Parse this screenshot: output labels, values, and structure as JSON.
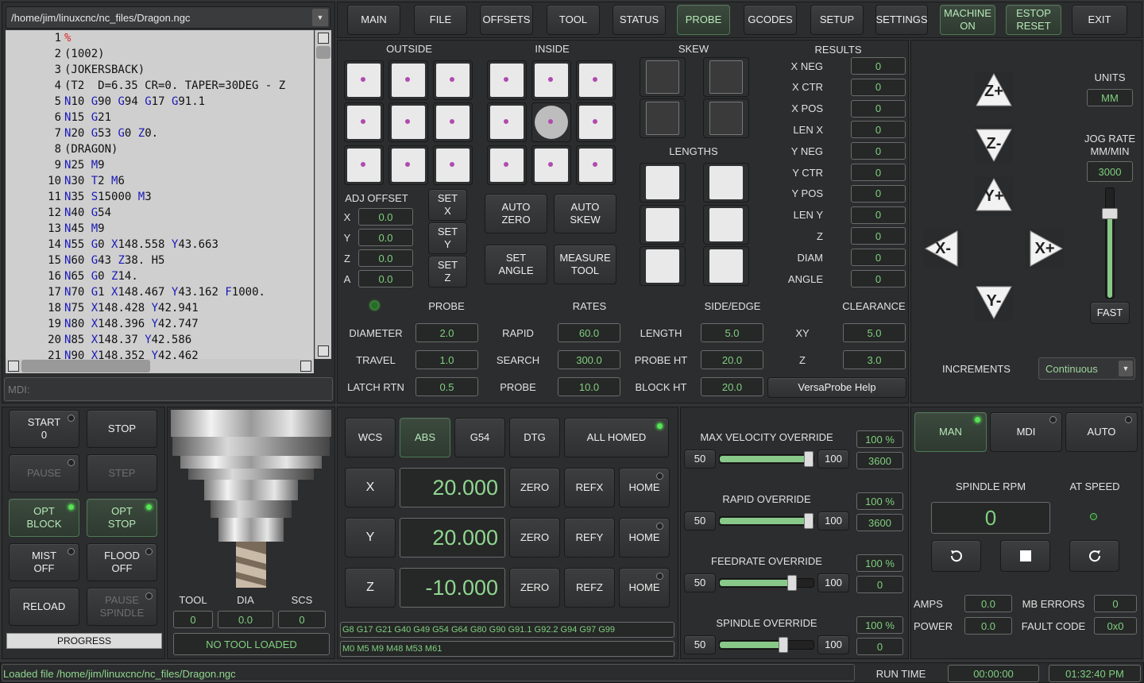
{
  "file": {
    "path": "/home/jim/linuxcnc/nc_files/Dragon.ngc"
  },
  "gcode_lines": [
    {
      "n": "1",
      "t": "%"
    },
    {
      "n": "2",
      "t": "(1002)"
    },
    {
      "n": "3",
      "t": "(JOKERSBACK)"
    },
    {
      "n": "4",
      "t": "(T2  D=6.35 CR=0. TAPER=30DEG - Z"
    },
    {
      "n": "5",
      "t": "N10 G90 G94 G17 G91.1"
    },
    {
      "n": "6",
      "t": "N15 G21"
    },
    {
      "n": "7",
      "t": "N20 G53 G0 Z0."
    },
    {
      "n": "8",
      "t": "(DRAGON)"
    },
    {
      "n": "9",
      "t": "N25 M9"
    },
    {
      "n": "10",
      "t": "N30 T2 M6"
    },
    {
      "n": "11",
      "t": "N35 S15000 M3"
    },
    {
      "n": "12",
      "t": "N40 G54"
    },
    {
      "n": "13",
      "t": "N45 M9"
    },
    {
      "n": "14",
      "t": "N55 G0 X148.558 Y43.663"
    },
    {
      "n": "15",
      "t": "N60 G43 Z38. H5"
    },
    {
      "n": "16",
      "t": "N65 G0 Z14."
    },
    {
      "n": "17",
      "t": "N70 G1 X148.467 Y43.162 F1000."
    },
    {
      "n": "18",
      "t": "N75 X148.428 Y42.941"
    },
    {
      "n": "19",
      "t": "N80 X148.396 Y42.747"
    },
    {
      "n": "20",
      "t": "N85 X148.37 Y42.586"
    },
    {
      "n": "21",
      "t": "N90 X148.352 Y42.462"
    }
  ],
  "mdi": {
    "placeholder": "MDI:"
  },
  "topnav": [
    "MAIN",
    "FILE",
    "OFFSETS",
    "TOOL",
    "STATUS",
    "PROBE",
    "GCODES",
    "SETUP",
    "SETTINGS"
  ],
  "topnav_right": {
    "machine_on": "MACHINE\nON",
    "estop_reset": "ESTOP\nRESET",
    "exit": "EXIT"
  },
  "probe": {
    "headers": {
      "outside": "OUTSIDE",
      "inside": "INSIDE",
      "skew": "SKEW",
      "results": "RESULTS",
      "lengths": "LENGTHS"
    },
    "results": [
      {
        "label": "X NEG",
        "value": "0"
      },
      {
        "label": "X CTR",
        "value": "0"
      },
      {
        "label": "X POS",
        "value": "0"
      },
      {
        "label": "LEN X",
        "value": "0"
      },
      {
        "label": "Y NEG",
        "value": "0"
      },
      {
        "label": "Y CTR",
        "value": "0"
      },
      {
        "label": "Y POS",
        "value": "0"
      },
      {
        "label": "LEN Y",
        "value": "0"
      },
      {
        "label": "Z",
        "value": "0"
      },
      {
        "label": "DIAM",
        "value": "0"
      },
      {
        "label": "ANGLE",
        "value": "0"
      }
    ],
    "adj_offset": {
      "title": "ADJ OFFSET",
      "rows": [
        {
          "axis": "X",
          "value": "0.0",
          "btn": "SET\nX"
        },
        {
          "axis": "Y",
          "value": "0.0",
          "btn": "SET\nY"
        },
        {
          "axis": "Z",
          "value": "0.0",
          "btn": "SET\nZ"
        },
        {
          "axis": "A",
          "value": "0.0"
        }
      ]
    },
    "buttons": {
      "auto_zero": "AUTO\nZERO",
      "auto_skew": "AUTO\nSKEW",
      "set_angle": "SET\nANGLE",
      "measure_tool": "MEASURE\nTOOL"
    },
    "section_headers": {
      "probe": "PROBE",
      "rates": "RATES",
      "side_edge": "SIDE/EDGE",
      "clearance": "CLEARANCE"
    },
    "params": [
      {
        "l1": "DIAMETER",
        "v1": "2.0",
        "l2": "RAPID",
        "v2": "60.0",
        "l3": "LENGTH",
        "v3": "5.0",
        "l4": "XY",
        "v4": "5.0"
      },
      {
        "l1": "TRAVEL",
        "v1": "1.0",
        "l2": "SEARCH",
        "v2": "300.0",
        "l3": "PROBE HT",
        "v3": "20.0",
        "l4": "Z",
        "v4": "3.0"
      },
      {
        "l1": "LATCH RTN",
        "v1": "0.5",
        "l2": "PROBE",
        "v2": "10.0",
        "l3": "BLOCK HT",
        "v3": "20.0"
      }
    ],
    "help": "VersaProbe Help"
  },
  "jog": {
    "units_label": "UNITS",
    "units": "MM",
    "jog_rate_label": "JOG RATE\nMM/MIN",
    "jog_rate": "3000",
    "jog_rate_pct": 0.76,
    "fast": "FAST",
    "increments_label": "INCREMENTS",
    "increments": "Continuous",
    "buttons": {
      "zplus": "Z+",
      "zminus": "Z-",
      "yplus": "Y+",
      "yminus": "Y-",
      "xminus": "X-",
      "xplus": "X+"
    }
  },
  "controls": {
    "start": "START\n0",
    "stop": "STOP",
    "pause": "PAUSE",
    "step": "STEP",
    "opt_block": "OPT\nBLOCK",
    "opt_stop": "OPT\nSTOP",
    "mist": "MIST\nOFF",
    "flood": "FLOOD\nOFF",
    "reload": "RELOAD",
    "pause_spindle": "PAUSE\nSPINDLE",
    "progress": "PROGRESS"
  },
  "tool": {
    "labels": [
      "TOOL",
      "DIA",
      "SCS"
    ],
    "values": [
      "0",
      "0.0",
      "0"
    ],
    "status": "NO TOOL LOADED"
  },
  "dro": {
    "wcs": "WCS",
    "abs": "ABS",
    "g54": "G54",
    "dtg": "DTG",
    "all_homed": "ALL HOMED",
    "axes": [
      {
        "axis": "X",
        "value": "20.000",
        "ref": "REFX"
      },
      {
        "axis": "Y",
        "value": "20.000",
        "ref": "REFY"
      },
      {
        "axis": "Z",
        "value": "-10.000",
        "ref": "REFZ"
      }
    ],
    "zero": "ZERO",
    "home": "HOME",
    "gcodes": "G8 G17 G21 G40 G49 G54 G64 G80 G90 G91.1 G92.2 G94 G97 G99",
    "mcodes": "M0 M5 M9 M48 M53 M61"
  },
  "overrides": [
    {
      "title": "MAX VELOCITY OVERRIDE",
      "min": "50",
      "max": "100",
      "pct": "100 %",
      "val": "3600",
      "pos": 1.0
    },
    {
      "title": "RAPID OVERRIDE",
      "min": "50",
      "max": "100",
      "pct": "100 %",
      "val": "3600",
      "pos": 1.0
    },
    {
      "title": "FEEDRATE OVERRIDE",
      "min": "50",
      "max": "100",
      "pct": "100 %",
      "val": "0",
      "pos": 0.8
    },
    {
      "title": "SPINDLE OVERRIDE",
      "min": "50",
      "max": "100",
      "pct": "100 %",
      "val": "0",
      "pos": 0.7
    }
  ],
  "spindle": {
    "man": "MAN",
    "mdi": "MDI",
    "auto": "AUTO",
    "rpm_label": "SPINDLE RPM",
    "at_speed": "AT SPEED",
    "rpm": "0",
    "stats": [
      {
        "label": "AMPS",
        "value": "0.0",
        "label2": "MB ERRORS",
        "value2": "0"
      },
      {
        "label": "POWER",
        "value": "0.0",
        "label2": "FAULT CODE",
        "value2": "0x0"
      }
    ]
  },
  "status": {
    "message": "Loaded file /home/jim/linuxcnc/nc_files/Dragon.ngc",
    "run_time_label": "RUN TIME",
    "run_time": "00:00:00",
    "clock": "01:32:40 PM"
  }
}
